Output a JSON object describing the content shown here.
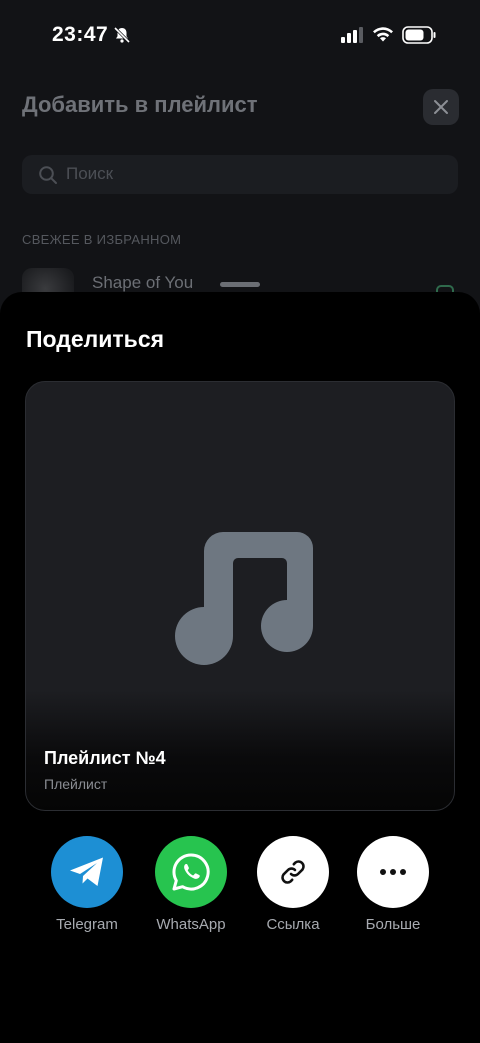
{
  "status_bar": {
    "time": "23:47",
    "icons": [
      "bell-slash-icon",
      "signal-icon",
      "wifi-icon",
      "battery-icon"
    ]
  },
  "background_screen": {
    "title": "Добавить в плейлист",
    "close_icon": "close-icon",
    "search": {
      "placeholder": "Поиск",
      "icon": "search-icon"
    },
    "section_header": "СВЕЖЕЕ В ИЗБРАННОМ",
    "songs": [
      {
        "title": "Shape of You"
      }
    ]
  },
  "share_sheet": {
    "title": "Поделиться",
    "playlist_card": {
      "name": "Плейлист №4",
      "type": "Плейлист",
      "cover_icon": "music-note-icon"
    },
    "targets": [
      {
        "label": "Telegram",
        "icon": "telegram-icon",
        "color": "#1d8fd4"
      },
      {
        "label": "WhatsApp",
        "icon": "whatsapp-icon",
        "color": "#27c44f"
      },
      {
        "label": "Ссылка",
        "icon": "link-icon",
        "color": "#ffffff"
      },
      {
        "label": "Больше",
        "icon": "more-icon",
        "color": "#ffffff"
      }
    ]
  }
}
